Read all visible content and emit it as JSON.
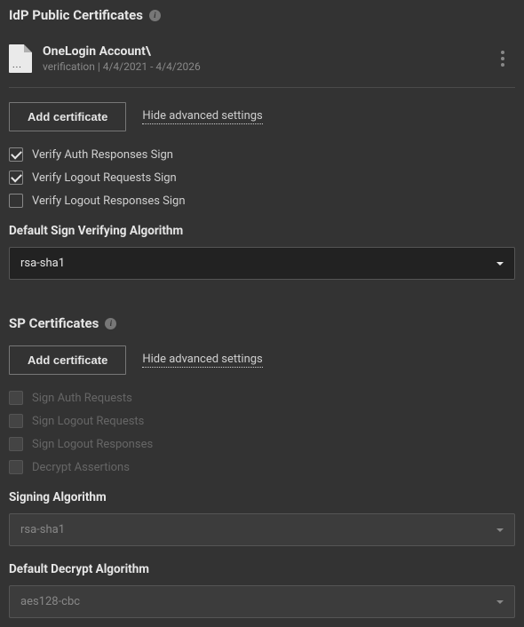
{
  "idp": {
    "title": "IdP Public Certificates",
    "cert": {
      "name": "OneLogin Account\\",
      "meta": "verification | 4/4/2021 - 4/4/2026"
    },
    "add_button": "Add certificate",
    "hide_link": "Hide advanced settings",
    "checks": [
      {
        "label": "Verify Auth Responses Sign",
        "checked": true
      },
      {
        "label": "Verify Logout Requests Sign",
        "checked": true
      },
      {
        "label": "Verify Logout Responses Sign",
        "checked": false
      }
    ],
    "algo_label": "Default Sign Verifying Algorithm",
    "algo_value": "rsa-sha1"
  },
  "sp": {
    "title": "SP Certificates",
    "add_button": "Add certificate",
    "hide_link": "Hide advanced settings",
    "checks": [
      {
        "label": "Sign Auth Requests"
      },
      {
        "label": "Sign Logout Requests"
      },
      {
        "label": "Sign Logout Responses"
      },
      {
        "label": "Decrypt Assertions"
      }
    ],
    "sign_algo_label": "Signing Algorithm",
    "sign_algo_value": "rsa-sha1",
    "decrypt_algo_label": "Default Decrypt Algorithm",
    "decrypt_algo_value": "aes128-cbc"
  }
}
